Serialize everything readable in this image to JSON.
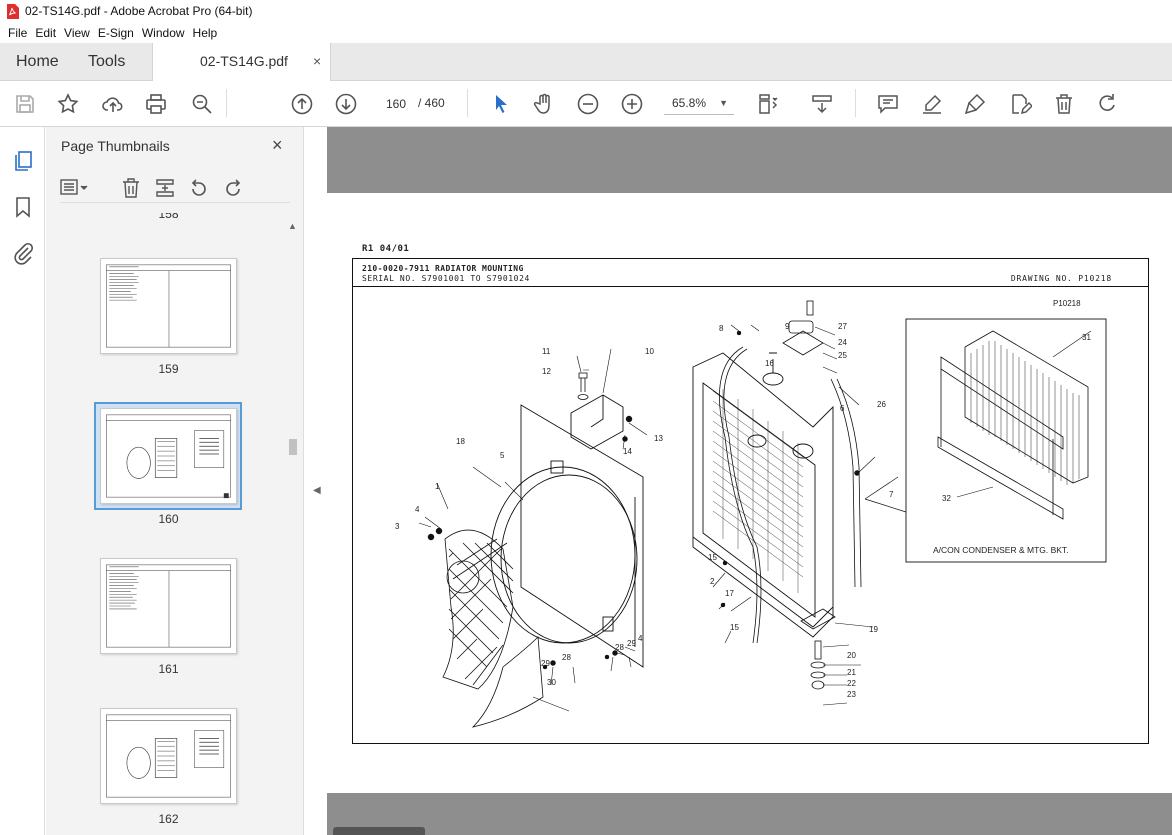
{
  "window": {
    "title": "02-TS14G.pdf - Adobe Acrobat Pro (64-bit)"
  },
  "menu": [
    "File",
    "Edit",
    "View",
    "E-Sign",
    "Window",
    "Help"
  ],
  "tabs": {
    "home": "Home",
    "tools": "Tools",
    "document": "02-TS14G.pdf",
    "close": "×"
  },
  "toolbar": {
    "current_page": "160",
    "total_pages": "/ 460",
    "zoom": "65.8%"
  },
  "sidebar": {
    "title": "Page Thumbnails",
    "close": "×",
    "thumbnails": [
      {
        "label": "158"
      },
      {
        "label": "159"
      },
      {
        "label": "160",
        "selected": true
      },
      {
        "label": "161"
      },
      {
        "label": "162"
      }
    ]
  },
  "document": {
    "revision": "R1 04/01",
    "title": "210-0020-7911 RADIATOR MOUNTING",
    "serial": "SERIAL NO. S7901001 TO S7901024",
    "drawing_no": "DRAWING NO. P10218",
    "drawing_code": "P10218",
    "inset_caption": "A/CON CONDENSER & MTG. BKT.",
    "callouts": [
      "1",
      "2",
      "3",
      "4",
      "4",
      "5",
      "6",
      "7",
      "8",
      "9",
      "10",
      "11",
      "12",
      "13",
      "14",
      "15",
      "15",
      "16",
      "17",
      "18",
      "19",
      "20",
      "21",
      "22",
      "23",
      "24",
      "25",
      "26",
      "27",
      "28",
      "28",
      "29",
      "29",
      "30",
      "31",
      "32"
    ]
  },
  "colors": {
    "accent": "#2a6fc9",
    "doc_bg": "#8e8e8e",
    "tabbar": "#e9e9e9",
    "panel": "#f3f3f3"
  }
}
